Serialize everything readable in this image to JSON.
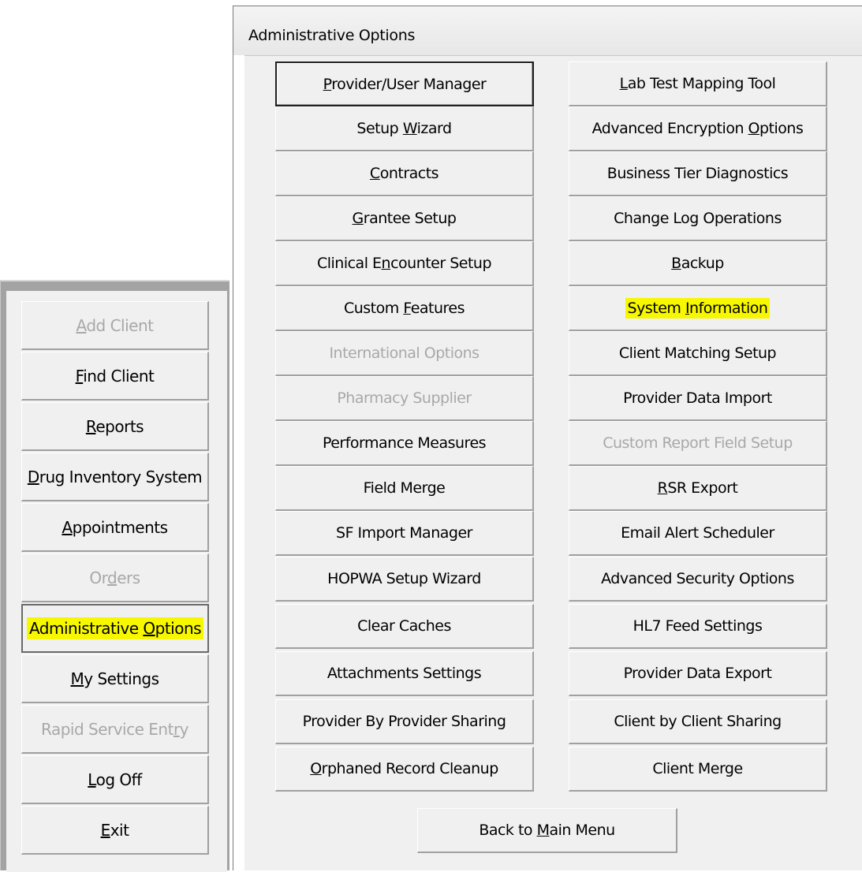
{
  "dialog": {
    "title": "Administrative Options",
    "left_column": [
      {
        "pre": "",
        "u": "P",
        "post": "rovider/User Manager",
        "enabled": true,
        "focused": true
      },
      {
        "pre": "Setup ",
        "u": "W",
        "post": "izard",
        "enabled": true
      },
      {
        "pre": "",
        "u": "C",
        "post": "ontracts",
        "enabled": true
      },
      {
        "pre": "",
        "u": "G",
        "post": "rantee Setup",
        "enabled": true
      },
      {
        "pre": "Clinical E",
        "u": "n",
        "post": "counter Setup",
        "enabled": true
      },
      {
        "pre": "Custom ",
        "u": "F",
        "post": "eatures",
        "enabled": true
      },
      {
        "pre": "International Options",
        "u": "",
        "post": "",
        "enabled": false
      },
      {
        "pre": "Pharmacy Supplier",
        "u": "",
        "post": "",
        "enabled": false
      },
      {
        "pre": "Performance Measures",
        "u": "",
        "post": "",
        "enabled": true
      },
      {
        "pre": "Field Merge",
        "u": "",
        "post": "",
        "enabled": true
      },
      {
        "pre": "SF Import Manager",
        "u": "",
        "post": "",
        "enabled": true
      },
      {
        "pre": "HOPWA Setup Wizard",
        "u": "",
        "post": "",
        "enabled": true
      },
      {
        "pre": "Clear Caches",
        "u": "",
        "post": "",
        "enabled": true
      },
      {
        "pre": "Attachments Settings",
        "u": "",
        "post": "",
        "enabled": true
      },
      {
        "pre": "Provider By Provider Sharing",
        "u": "",
        "post": "",
        "enabled": true
      },
      {
        "pre": "",
        "u": "O",
        "post": "rphaned Record Cleanup",
        "enabled": true
      }
    ],
    "right_column": [
      {
        "pre": "",
        "u": "L",
        "post": "ab Test Mapping Tool",
        "enabled": true
      },
      {
        "pre": "Advanced Encryption ",
        "u": "O",
        "post": "ptions",
        "enabled": true
      },
      {
        "pre": "Business Tier Diagnostics",
        "u": "",
        "post": "",
        "enabled": true
      },
      {
        "pre": "Change Log Operations",
        "u": "",
        "post": "",
        "enabled": true
      },
      {
        "pre": "",
        "u": "B",
        "post": "ackup",
        "enabled": true
      },
      {
        "pre": "System ",
        "u": "I",
        "post": "nformation",
        "enabled": true,
        "highlighted": true
      },
      {
        "pre": "Client Matching Setup",
        "u": "",
        "post": "",
        "enabled": true
      },
      {
        "pre": "Provider Data Import",
        "u": "",
        "post": "",
        "enabled": true
      },
      {
        "pre": "Custom Report Field Setup",
        "u": "",
        "post": "",
        "enabled": false
      },
      {
        "pre": "",
        "u": "R",
        "post": "SR Export",
        "enabled": true
      },
      {
        "pre": "Email Alert Scheduler",
        "u": "",
        "post": "",
        "enabled": true
      },
      {
        "pre": "Advanced Security Options",
        "u": "",
        "post": "",
        "enabled": true
      },
      {
        "pre": "HL7 Feed Settings",
        "u": "",
        "post": "",
        "enabled": true
      },
      {
        "pre": "Provider Data Export",
        "u": "",
        "post": "",
        "enabled": true
      },
      {
        "pre": "Client by Client Sharing",
        "u": "",
        "post": "",
        "enabled": true
      },
      {
        "pre": "Client Merge",
        "u": "",
        "post": "",
        "enabled": true
      }
    ],
    "back_button": {
      "pre": "Back to ",
      "u": "M",
      "post": "ain Menu"
    }
  },
  "nav": {
    "items": [
      {
        "pre": "",
        "u": "A",
        "post": "dd Client",
        "enabled": false
      },
      {
        "pre": "",
        "u": "F",
        "post": "ind Client",
        "enabled": true
      },
      {
        "pre": "",
        "u": "R",
        "post": "eports",
        "enabled": true
      },
      {
        "pre": "",
        "u": "D",
        "post": "rug Inventory System",
        "enabled": true
      },
      {
        "pre": "",
        "u": "A",
        "post": "ppointments",
        "enabled": true
      },
      {
        "pre": "Or",
        "u": "d",
        "post": "ers",
        "enabled": false
      },
      {
        "pre": "Administrative ",
        "u": "O",
        "post": "ptions",
        "enabled": true,
        "active": true,
        "highlighted": true
      },
      {
        "pre": "",
        "u": "M",
        "post": "y Settings",
        "enabled": true
      },
      {
        "pre": "Rapid Service Ent",
        "u": "r",
        "post": "y",
        "enabled": false
      },
      {
        "pre": "",
        "u": "L",
        "post": "og Off",
        "enabled": true
      },
      {
        "pre": "",
        "u": "E",
        "post": "xit",
        "enabled": true
      }
    ]
  },
  "colors": {
    "highlight": "#f7f700",
    "disabled_text": "#a8a8a8",
    "button_face": "#f0f0f0"
  }
}
